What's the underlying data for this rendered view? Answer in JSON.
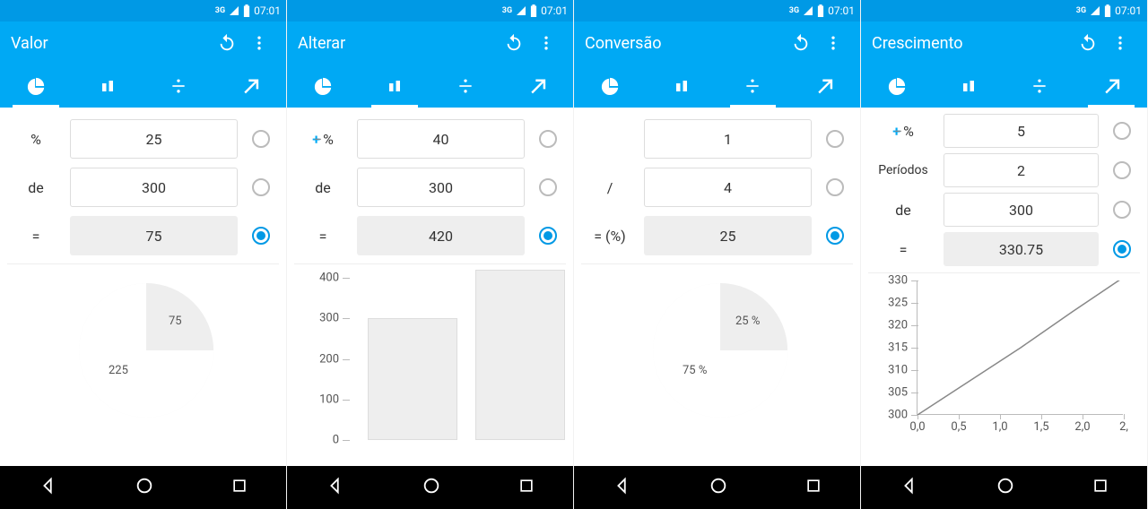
{
  "status": {
    "network": "3G",
    "time": "07:01"
  },
  "panes": [
    {
      "title": "Valor",
      "active_tab": 0,
      "rows": [
        {
          "label_kind": "pct",
          "label": "%",
          "value": "25",
          "result": false,
          "selected": false
        },
        {
          "label_kind": "txt",
          "label": "de",
          "value": "300",
          "result": false,
          "selected": false
        },
        {
          "label_kind": "txt",
          "label": "=",
          "value": "75",
          "result": true,
          "selected": true
        }
      ]
    },
    {
      "title": "Alterar",
      "active_tab": 1,
      "rows": [
        {
          "label_kind": "pm",
          "label": "%",
          "value": "40",
          "result": false,
          "selected": false
        },
        {
          "label_kind": "txt",
          "label": "de",
          "value": "300",
          "result": false,
          "selected": false
        },
        {
          "label_kind": "txt",
          "label": "=",
          "value": "420",
          "result": true,
          "selected": true
        }
      ]
    },
    {
      "title": "Conversão",
      "active_tab": 2,
      "rows": [
        {
          "label_kind": "none",
          "label": "",
          "value": "1",
          "result": false,
          "selected": false
        },
        {
          "label_kind": "txt",
          "label": "/",
          "value": "4",
          "result": false,
          "selected": false
        },
        {
          "label_kind": "txt",
          "label": "= (%)",
          "value": "25",
          "result": true,
          "selected": true
        }
      ]
    },
    {
      "title": "Crescimento",
      "active_tab": 3,
      "rows": [
        {
          "label_kind": "pm",
          "label": "%",
          "value": "5",
          "result": false,
          "selected": false
        },
        {
          "label_kind": "txt",
          "label": "Períodos",
          "value": "2",
          "result": false,
          "selected": false
        },
        {
          "label_kind": "txt",
          "label": "de",
          "value": "300",
          "result": false,
          "selected": false
        },
        {
          "label_kind": "txt",
          "label": "=",
          "value": "330.75",
          "result": true,
          "selected": true
        }
      ]
    }
  ],
  "chart_data": [
    {
      "type": "pie",
      "categories": [
        "75",
        "225"
      ],
      "values": [
        75,
        225
      ],
      "title": "",
      "xlabel": "",
      "ylabel": "",
      "ylim": []
    },
    {
      "type": "bar",
      "categories": [
        "",
        ""
      ],
      "values": [
        300,
        420
      ],
      "title": "",
      "xlabel": "",
      "ylabel": "",
      "ylim": [
        0,
        420
      ],
      "yticks": [
        0,
        100,
        200,
        300,
        400
      ]
    },
    {
      "type": "pie",
      "categories": [
        "25 %",
        "75 %"
      ],
      "values": [
        25,
        75
      ],
      "title": "",
      "xlabel": "",
      "ylabel": "",
      "ylim": []
    },
    {
      "type": "line",
      "x": [
        0,
        0.5,
        1.0,
        1.5,
        2.0
      ],
      "values": [
        300,
        307.5,
        315,
        323,
        330.75
      ],
      "xlabel": "",
      "ylabel": "",
      "ylim": [
        300,
        330
      ],
      "yticks": [
        300,
        305,
        310,
        315,
        320,
        325,
        330
      ],
      "xticks": [
        "0,0",
        "0,5",
        "1,0",
        "1,5",
        "2,0",
        "2,"
      ]
    }
  ]
}
